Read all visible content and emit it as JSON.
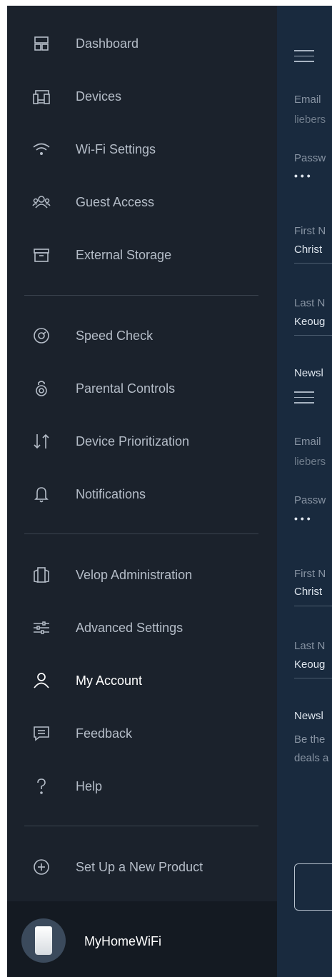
{
  "nav": {
    "items": [
      {
        "name": "dashboard",
        "label": "Dashboard",
        "icon": "dashboard-icon"
      },
      {
        "name": "devices",
        "label": "Devices",
        "icon": "devices-icon"
      },
      {
        "name": "wifi-settings",
        "label": "Wi-Fi Settings",
        "icon": "wifi-icon"
      },
      {
        "name": "guest-access",
        "label": "Guest Access",
        "icon": "guests-icon"
      },
      {
        "name": "external-storage",
        "label": "External Storage",
        "icon": "storage-icon"
      },
      {
        "name": "speed-check",
        "label": "Speed Check",
        "icon": "speedometer-icon"
      },
      {
        "name": "parental-controls",
        "label": "Parental Controls",
        "icon": "parental-lock-icon"
      },
      {
        "name": "device-prioritization",
        "label": "Device Prioritization",
        "icon": "priority-arrows-icon"
      },
      {
        "name": "notifications",
        "label": "Notifications",
        "icon": "bell-icon"
      },
      {
        "name": "velop-administration",
        "label": "Velop Administration",
        "icon": "node-admin-icon"
      },
      {
        "name": "advanced-settings",
        "label": "Advanced Settings",
        "icon": "sliders-icon"
      },
      {
        "name": "my-account",
        "label": "My Account",
        "icon": "user-icon",
        "active": true
      },
      {
        "name": "feedback",
        "label": "Feedback",
        "icon": "chat-bubble-icon"
      },
      {
        "name": "help",
        "label": "Help",
        "icon": "question-mark-icon"
      },
      {
        "name": "set-up-new-product",
        "label": "Set Up a New Product",
        "icon": "plus-circle-icon"
      }
    ]
  },
  "network": {
    "name": "MyHomeWiFi",
    "icon": "velop-node-icon"
  },
  "background": {
    "upper": {
      "email_label": "Email",
      "email_value": "liebers",
      "password_label": "Passw",
      "password_value": "•••",
      "first_name_label": "First N",
      "first_name_value": "Christ",
      "last_name_label": "Last N",
      "last_name_value": "Keoug",
      "newsletter_label": "Newsl"
    },
    "lower": {
      "email_label": "Email",
      "email_value": "liebers",
      "password_label": "Passw",
      "password_value": "•••",
      "first_name_label": "First N",
      "first_name_value": "Christ",
      "last_name_label": "Last N",
      "last_name_value": "Keoug",
      "newsletter_label": "Newsl",
      "newsletter_text_1": "Be the",
      "newsletter_text_2": "deals a"
    }
  },
  "colors": {
    "drawer_bg": "#1b222c",
    "panel_bg": "#192a3e",
    "label_color": "#b5bdc8",
    "active_color": "#ffffff"
  }
}
